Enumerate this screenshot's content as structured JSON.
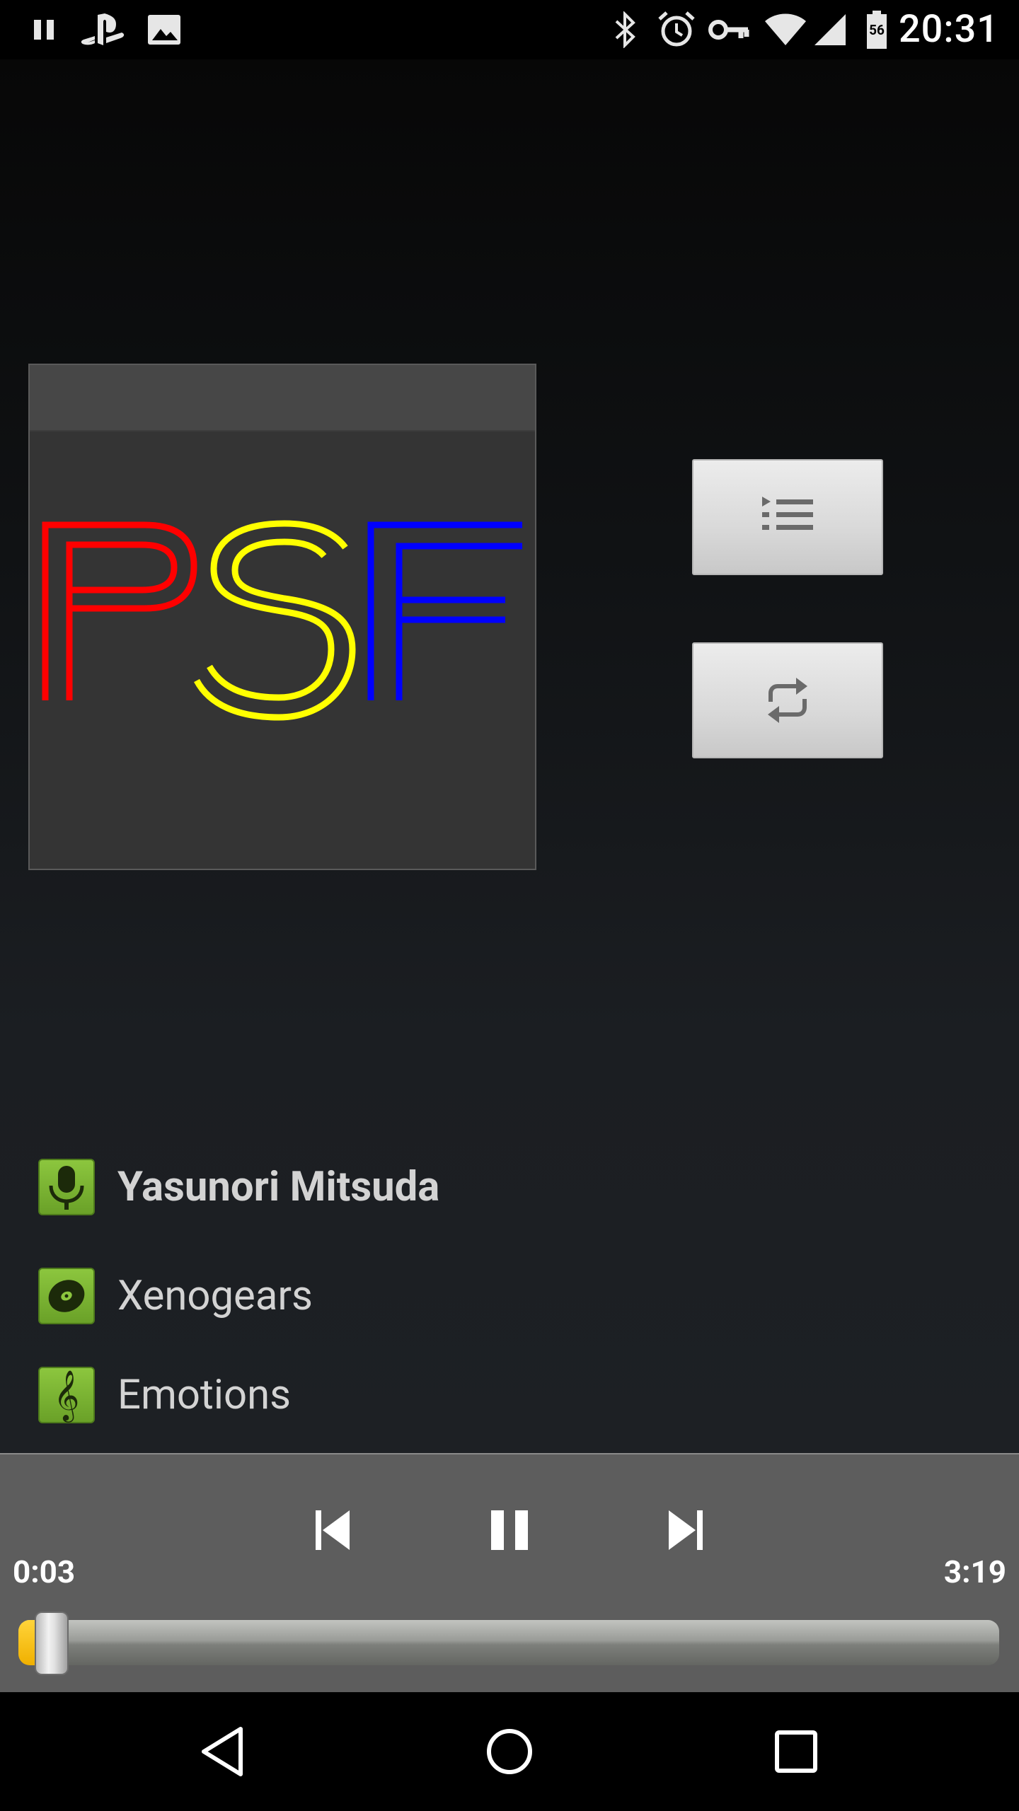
{
  "status_bar": {
    "time": "20:31",
    "battery_level": "56",
    "left_icons": [
      "pause-icon",
      "playstation-icon",
      "image-icon"
    ],
    "right_icons": [
      "bluetooth-icon",
      "alarm-icon",
      "vpn-key-icon",
      "wifi-icon",
      "signal-icon",
      "battery-icon"
    ]
  },
  "album_art": {
    "letters": [
      "P",
      "S",
      "F"
    ],
    "colors": [
      "#ff0000",
      "#ffff00",
      "#0000ff"
    ]
  },
  "side_buttons": {
    "queue_icon": "queue-list-icon",
    "repeat_icon": "repeat-icon"
  },
  "track": {
    "artist": "Yasunori Mitsuda",
    "album": "Xenogears",
    "title": "Emotions"
  },
  "player": {
    "elapsed": "0:03",
    "total": "3:19",
    "progress": 0.015,
    "accent_color": "#f0b000"
  },
  "nav": {
    "icons": [
      "back-icon",
      "home-icon",
      "recents-icon"
    ]
  }
}
